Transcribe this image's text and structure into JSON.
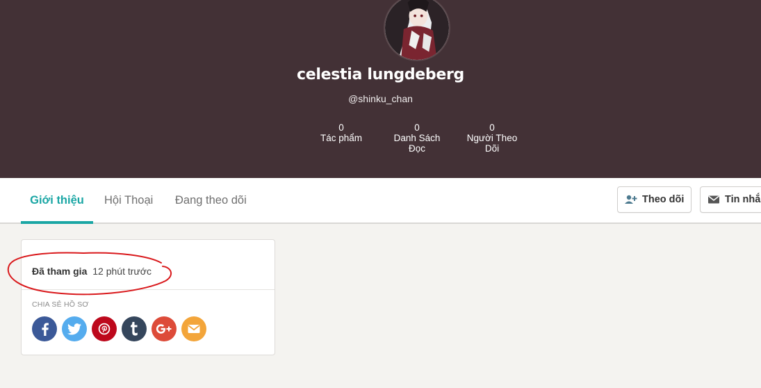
{
  "profile": {
    "display_name": "celestia lungdeberg",
    "username": "@shinku_chan",
    "stats": [
      {
        "value": "0",
        "label": "Tác phẩm"
      },
      {
        "value": "0",
        "label": "Danh Sách Đọc"
      },
      {
        "value": "0",
        "label": "Người Theo Dõi"
      }
    ]
  },
  "tabs": [
    {
      "label": "Giới thiệu",
      "active": true
    },
    {
      "label": "Hội Thoại",
      "active": false
    },
    {
      "label": "Đang theo dõi",
      "active": false
    }
  ],
  "actions": {
    "follow_label": "Theo dõi",
    "message_label": "Tin nhắn"
  },
  "about": {
    "joined_label": "Đã tham gia",
    "joined_value": "12 phút trước",
    "share_label": "CHIA SẺ HỒ SƠ",
    "share_buttons": [
      {
        "icon": "facebook-icon",
        "color": "#3b5998"
      },
      {
        "icon": "twitter-icon",
        "color": "#55acee"
      },
      {
        "icon": "pinterest-icon",
        "color": "#bd081c"
      },
      {
        "icon": "tumblr-icon",
        "color": "#35465c"
      },
      {
        "icon": "google-plus-icon",
        "color": "#dd4b39"
      },
      {
        "icon": "email-icon",
        "color": "#f3a53a"
      }
    ]
  },
  "colors": {
    "header_bg": "#433136",
    "accent": "#1aa6a4",
    "annotation": "#d9181b"
  }
}
